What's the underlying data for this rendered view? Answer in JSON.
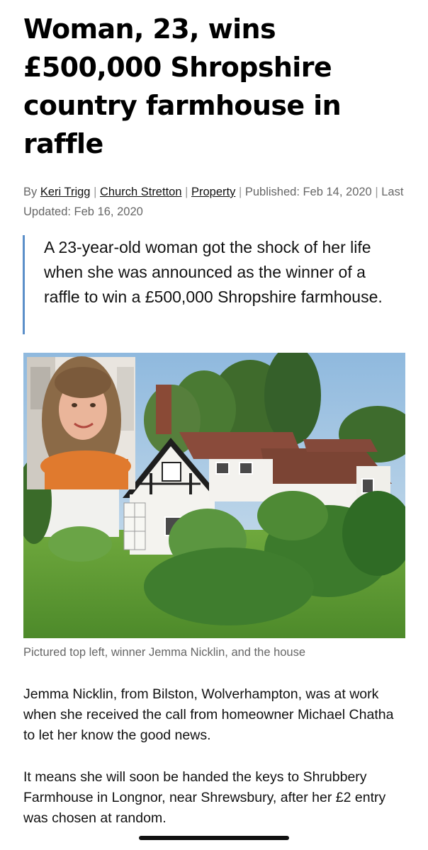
{
  "article": {
    "headline": "Woman, 23, wins £500,000 Shropshire country farmhouse in raffle",
    "byline": {
      "by_prefix": "By",
      "author": "Keri Trigg",
      "location": "Church Stretton",
      "category": "Property",
      "published": "Published: Feb 14, 2020",
      "updated": "Last Updated: Feb 16, 2020"
    },
    "lede": "A 23-year-old woman got the shock of her life when she was announced as the winner of a raffle to win a £500,000 Shropshire farmhouse.",
    "image": {
      "caption": "Pictured top left, winner Jemma Nicklin, and the house"
    },
    "paragraphs": [
      "Jemma Nicklin, from Bilston, Wolverhampton, was at work when she received the call from homeowner Michael Chatha to let her know the good news.",
      "It means she will soon be handed the keys to Shrubbery Farmhouse in Longnor, near Shrewsbury, after her £2 entry was chosen at random."
    ]
  },
  "colors": {
    "quote_border": "#5b8fc9",
    "link_text": "#111111",
    "meta_text": "#666666"
  }
}
